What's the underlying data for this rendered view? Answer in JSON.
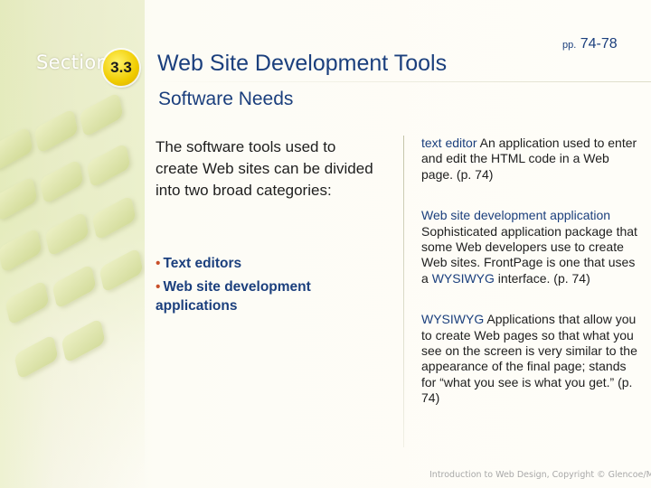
{
  "header": {
    "section_word": "Section",
    "section_number": "3.3",
    "title": "Web Site Development Tools",
    "pages_prefix": "pp.",
    "pages_range": "74-78"
  },
  "subtitle": "Software Needs",
  "left": {
    "lead": "The software tools used to create Web sites can be divided into two broad categories:",
    "bullets": [
      "Text editors",
      "Web site development applications"
    ],
    "bullet_marker": "•"
  },
  "definitions": [
    {
      "term": "text editor",
      "body": " An application used to enter and edit the HTML code in a Web page. (p. 74)"
    },
    {
      "term": "Web site development application",
      "body_before": " Sophisticated application package that some Web developers use to create Web sites. Front",
      "body_mid": "Page is one that uses a ",
      "highlight": "WYSIWYG",
      "body_after": " interface. (p. 74)"
    },
    {
      "term": "WYSIWYG",
      "body": " Applications that allow you to create Web pages so that what you see on the screen is very similar to the appearance of the final page; stands for “what you see is what you get.” (p. 74)"
    }
  ],
  "footer": "Introduction to Web Design, Copyright © Glencoe/McGraw-Hill",
  "colors": {
    "accent_blue": "#1b3f7d",
    "badge_yellow": "#f0cc00",
    "bullet_red": "#c94f2a"
  }
}
